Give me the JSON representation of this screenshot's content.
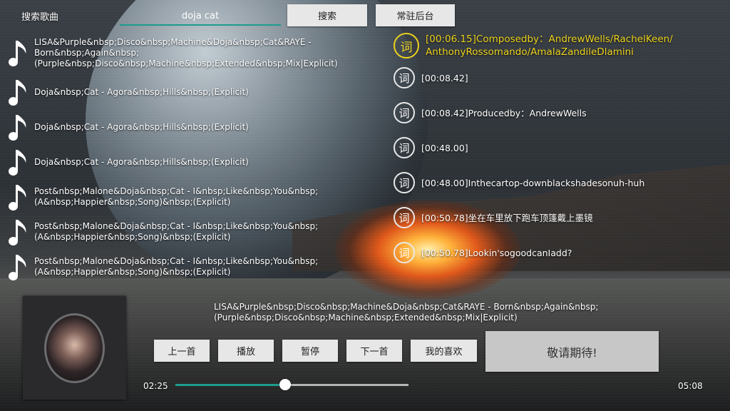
{
  "header": {
    "search_label": "搜索歌曲",
    "search_value": "doja cat",
    "search_button": "搜索",
    "background_button": "常驻后台"
  },
  "songs": [
    {
      "title": "LISA&Purple&nbsp;Disco&nbsp;Machine&Doja&nbsp;Cat&RAYE - Born&nbsp;Again&nbsp; (Purple&nbsp;Disco&nbsp;Machine&nbsp;Extended&nbsp;Mix|Explicit)",
      "icon": "music-note-icon"
    },
    {
      "title": "Doja&nbsp;Cat - Agora&nbsp;Hills&nbsp;(Explicit)",
      "icon": "music-note-icon"
    },
    {
      "title": "Doja&nbsp;Cat - Agora&nbsp;Hills&nbsp;(Explicit)",
      "icon": "music-note-icon"
    },
    {
      "title": "Doja&nbsp;Cat - Agora&nbsp;Hills&nbsp;(Explicit)",
      "icon": "music-note-icon"
    },
    {
      "title": "Post&nbsp;Malone&Doja&nbsp;Cat - I&nbsp;Like&nbsp;You&nbsp; (A&nbsp;Happier&nbsp;Song)&nbsp;(Explicit)",
      "icon": "music-note-icon"
    },
    {
      "title": "Post&nbsp;Malone&Doja&nbsp;Cat - I&nbsp;Like&nbsp;You&nbsp; (A&nbsp;Happier&nbsp;Song)&nbsp;(Explicit)",
      "icon": "music-note-icon"
    },
    {
      "title": "Post&nbsp;Malone&Doja&nbsp;Cat - I&nbsp;Like&nbsp;You&nbsp; (A&nbsp;Happier&nbsp;Song)&nbsp;(Explicit)",
      "icon": "music-note-icon"
    }
  ],
  "lyrics": [
    {
      "badge": "词",
      "text": "[00:06.15]Composedby：AndrewWells/RachelKeen/ AnthonyRossomando/AmalaZandileDlamini",
      "active": true
    },
    {
      "badge": "词",
      "text": "[00:08.42]",
      "active": false
    },
    {
      "badge": "词",
      "text": "[00:08.42]Producedby：AndrewWells",
      "active": false
    },
    {
      "badge": "词",
      "text": "[00:48.00]",
      "active": false
    },
    {
      "badge": "词",
      "text": "[00:48.00]Inthecartop-downblackshadesonuh-huh",
      "active": false
    },
    {
      "badge": "词",
      "text": "[00:50.78]坐在车里放下跑车顶篷戴上墨镜",
      "active": false
    },
    {
      "badge": "词",
      "text": "[00:50.78]Lookin'sogoodcanIadd?",
      "active": false
    }
  ],
  "player": {
    "now_playing": "LISA&Purple&nbsp;Disco&nbsp;Machine&Doja&nbsp;Cat&RAYE - Born&nbsp;Again&nbsp; (Purple&nbsp;Disco&nbsp;Machine&nbsp;Extended&nbsp;Mix|Explicit)",
    "buttons": {
      "prev": "上一首",
      "play": "播放",
      "pause": "暂停",
      "next": "下一首",
      "favorites": "我的喜欢"
    },
    "coming_soon": "敬请期待!",
    "current_time": "02:25",
    "total_time": "05:08",
    "progress": 0.47
  },
  "colors": {
    "accent": "#1e9c8c",
    "active_lyric": "#ecd21d"
  }
}
